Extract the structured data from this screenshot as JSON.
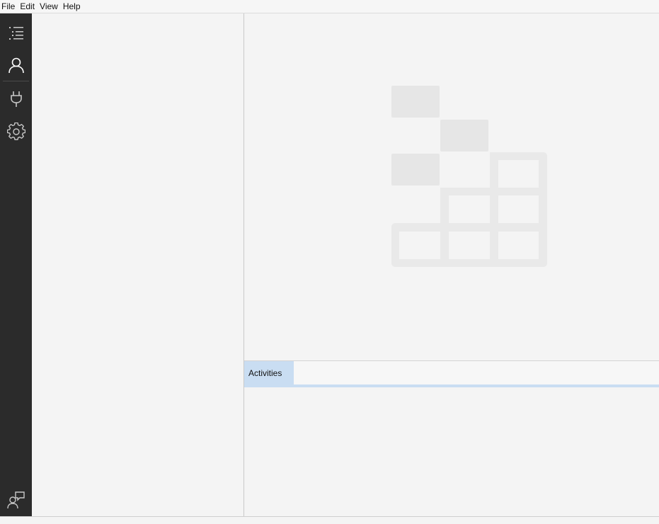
{
  "menu": {
    "items": [
      {
        "label": "File"
      },
      {
        "label": "Edit"
      },
      {
        "label": "View"
      },
      {
        "label": "Help"
      }
    ]
  },
  "activity_bar": {
    "items": [
      {
        "icon": "list-icon",
        "name": "explorer"
      },
      {
        "icon": "user-icon",
        "name": "accounts",
        "selected": true
      },
      {
        "icon": "plug-icon",
        "name": "connections"
      },
      {
        "icon": "gear-icon",
        "name": "settings"
      }
    ],
    "bottom_item": {
      "icon": "user-feedback-icon",
      "name": "feedback"
    }
  },
  "bottom_panel": {
    "tabs": [
      {
        "label": "Activities",
        "active": true
      }
    ]
  },
  "colors": {
    "activity_bar_bg": "#2b2b2b",
    "activity_icon": "#c8c8c8",
    "active_tab_bg": "#c9ddf2",
    "watermark": "#e6e6e6"
  }
}
